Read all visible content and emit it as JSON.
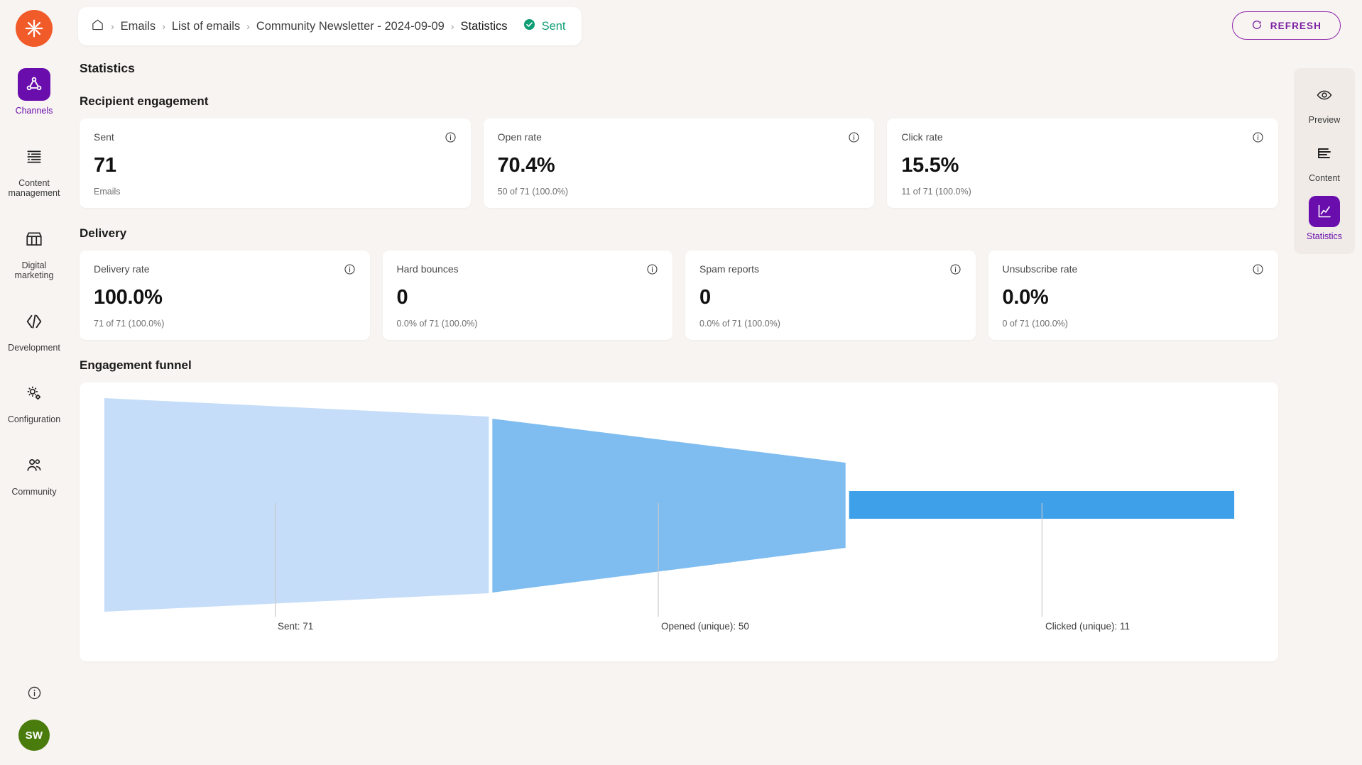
{
  "brand": {
    "logo_icon": "flower-burst-logo",
    "logo_color": "#f15a29"
  },
  "sidebar": {
    "items": [
      {
        "label": "Channels",
        "icon": "channels-node-icon",
        "active": true
      },
      {
        "label": "Content management",
        "icon": "content-list-icon",
        "active": false
      },
      {
        "label": "Digital marketing",
        "icon": "storefront-icon",
        "active": false
      },
      {
        "label": "Development",
        "icon": "code-brackets-icon",
        "active": false
      },
      {
        "label": "Configuration",
        "icon": "gears-icon",
        "active": false
      },
      {
        "label": "Community",
        "icon": "people-group-icon",
        "active": false
      }
    ],
    "bottom": {
      "info_icon": "info-circle-icon",
      "avatar_initials": "SW",
      "avatar_color": "#4a7c0d"
    }
  },
  "breadcrumb": {
    "home_icon": "home-icon",
    "separator": "›",
    "items": [
      {
        "label": "Emails"
      },
      {
        "label": "List of emails"
      },
      {
        "label": "Community Newsletter - 2024-09-09"
      },
      {
        "label": "Statistics"
      }
    ],
    "status": {
      "label": "Sent",
      "icon": "check-circle-icon",
      "color": "#0f9d76"
    }
  },
  "toolbar": {
    "refresh_label": "REFRESH",
    "refresh_icon": "refresh-circle-icon",
    "accent": "#7b1fa2"
  },
  "main": {
    "page_title": "Statistics",
    "sections": [
      {
        "title": "Recipient engagement",
        "cards": [
          {
            "label": "Sent",
            "value": "71",
            "sub": "Emails",
            "info_icon": "info-circle-icon"
          },
          {
            "label": "Open rate",
            "value": "70.4%",
            "sub": "50 of 71 (100.0%)",
            "info_icon": "info-circle-icon"
          },
          {
            "label": "Click rate",
            "value": "15.5%",
            "sub": "11 of 71 (100.0%)",
            "info_icon": "info-circle-icon"
          }
        ]
      },
      {
        "title": "Delivery",
        "cards": [
          {
            "label": "Delivery rate",
            "value": "100.0%",
            "sub": "71 of 71 (100.0%)",
            "info_icon": "info-circle-icon"
          },
          {
            "label": "Hard bounces",
            "value": "0",
            "sub": "0.0% of 71 (100.0%)",
            "info_icon": "info-circle-icon"
          },
          {
            "label": "Spam reports",
            "value": "0",
            "sub": "0.0% of 71 (100.0%)",
            "info_icon": "info-circle-icon"
          },
          {
            "label": "Unsubscribe rate",
            "value": "0.0%",
            "sub": "0 of 71 (100.0%)",
            "info_icon": "info-circle-icon"
          }
        ]
      }
    ],
    "funnel_title": "Engagement funnel"
  },
  "chart_data": {
    "type": "area",
    "title": "Engagement funnel",
    "categories": [
      "Sent",
      "Opened (unique)",
      "Clicked (unique)"
    ],
    "values": [
      71,
      50,
      11
    ],
    "tick_labels": [
      "Sent: 71",
      "Opened (unique): 50",
      "Clicked (unique): 11"
    ],
    "colors": [
      "#c5ddf8",
      "#7fbdf0",
      "#3fa0ea"
    ],
    "xlabel": "",
    "ylabel": "",
    "ylim": [
      0,
      71
    ],
    "grid": false,
    "legend": "none"
  },
  "right_rail": {
    "items": [
      {
        "label": "Preview",
        "icon": "eye-icon",
        "active": false
      },
      {
        "label": "Content",
        "icon": "content-lines-icon",
        "active": false
      },
      {
        "label": "Statistics",
        "icon": "chart-icon",
        "active": true
      }
    ]
  }
}
